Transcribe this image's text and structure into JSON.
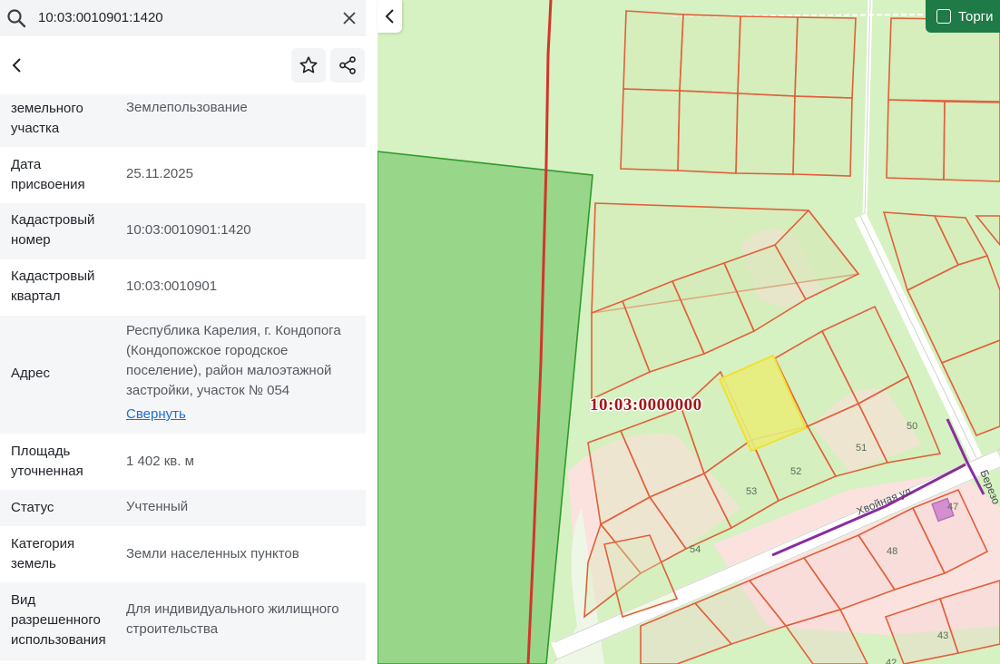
{
  "search": {
    "value": "10:03:0010901:1420"
  },
  "details": [
    {
      "label": "земельного участка",
      "value": "Землепользование"
    },
    {
      "label": "Дата присвоения",
      "value": "25.11.2025"
    },
    {
      "label": "Кадастровый номер",
      "value": "10:03:0010901:1420"
    },
    {
      "label": "Кадастровый квартал",
      "value": "10:03:0010901"
    },
    {
      "label": "Адрес",
      "value": "Республика Карелия, г. Кондопога (Кондопожское городское поселение), район малоэтажной застройки, участок № 054",
      "link": "Свернуть"
    },
    {
      "label": "Площадь уточненная",
      "value": "1 402 кв. м"
    },
    {
      "label": "Статус",
      "value": "Учтенный"
    },
    {
      "label": "Категория земель",
      "value": "Земли населенных пунктов"
    },
    {
      "label": "Вид разрешенного использования",
      "value": "Для индивидуального жилищного строительства"
    }
  ],
  "map": {
    "toggle_label": "Торги",
    "quarter_label": "10:03:0000000",
    "street_labels": [
      "Хвойная ул.",
      "Березо"
    ],
    "plot_numbers": [
      "50",
      "51",
      "52",
      "53",
      "54",
      "48",
      "47",
      "43",
      "42"
    ]
  },
  "colors": {
    "accent_green": "#1e7a46",
    "plot_border": "#e0603a",
    "selected_plot": "#e8ec7a",
    "forest": "#98d68a",
    "map_bg": "#d6f1c2"
  }
}
